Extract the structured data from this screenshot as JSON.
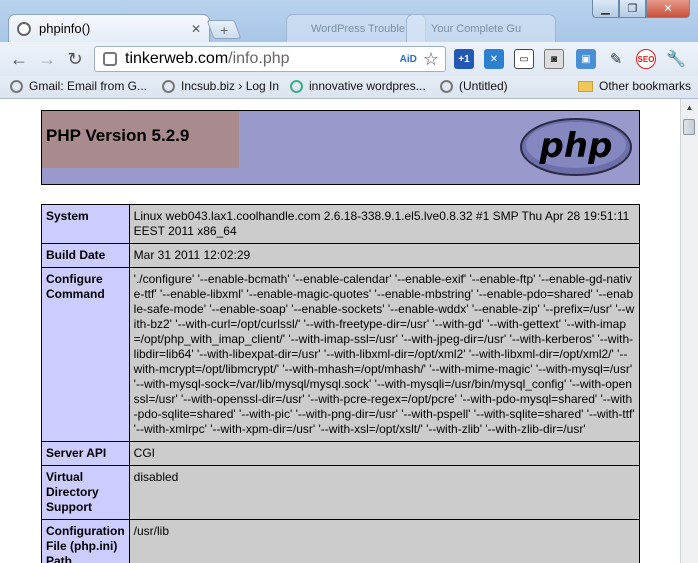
{
  "browser": {
    "active_tab_title": "phpinfo()",
    "ghost_tab_1": "WordPress Trouble",
    "ghost_tab_2": "Your Complete Gu",
    "url_host": "tinkerweb.com",
    "url_path": "/info.php",
    "ext_label": "AiD"
  },
  "bookmarks": [
    "Gmail: Email from G...",
    "Incsub.biz › Log In",
    "innovative wordpres...",
    "(Untitled)"
  ],
  "other_bookmarks": "Other bookmarks",
  "page": {
    "php_version": "PHP Version 5.2.9",
    "rows": [
      {
        "key": "System",
        "value": "Linux web043.lax1.coolhandle.com 2.6.18-338.9.1.el5.lve0.8.32 #1 SMP Thu Apr 28 19:51:11 EEST 2011 x86_64"
      },
      {
        "key": "Build Date",
        "value": "Mar 31 2011 12:02:29"
      },
      {
        "key": "Configure Command",
        "value": "'./configure' '--enable-bcmath' '--enable-calendar' '--enable-exif' '--enable-ftp' '--enable-gd-native-ttf' '--enable-libxml' '--enable-magic-quotes' '--enable-mbstring' '--enable-pdo=shared' '--enable-safe-mode' '--enable-soap' '--enable-sockets' '--enable-wddx' '--enable-zip' '--prefix=/usr' '--with-bz2' '--with-curl=/opt/curlssl/' '--with-freetype-dir=/usr' '--with-gd' '--with-gettext' '--with-imap=/opt/php_with_imap_client/' '--with-imap-ssl=/usr' '--with-jpeg-dir=/usr' '--with-kerberos' '--with-libdir=lib64' '--with-libexpat-dir=/usr' '--with-libxml-dir=/opt/xml2' '--with-libxml-dir=/opt/xml2/' '--with-mcrypt=/opt/libmcrypt/' '--with-mhash=/opt/mhash/' '--with-mime-magic' '--with-mysql=/usr' '--with-mysql-sock=/var/lib/mysql/mysql.sock' '--with-mysqli=/usr/bin/mysql_config' '--with-openssl=/usr' '--with-openssl-dir=/usr' '--with-pcre-regex=/opt/pcre' '--with-pdo-mysql=shared' '--with-pdo-sqlite=shared' '--with-pic' '--with-png-dir=/usr' '--with-pspell' '--with-sqlite=shared' '--with-ttf' '--with-xmlrpc' '--with-xpm-dir=/usr' '--with-xsl=/opt/xslt/' '--with-zlib' '--with-zlib-dir=/usr'"
      },
      {
        "key": "Server API",
        "value": "CGI"
      },
      {
        "key": "Virtual Directory Support",
        "value": "disabled"
      },
      {
        "key": "Configuration File (php.ini) Path",
        "value": "/usr/lib"
      }
    ]
  },
  "colors": {
    "header_bg": "#9999cc",
    "key_bg": "#ccccff",
    "value_bg": "#cccccc",
    "version_bg": "#a88a8f"
  }
}
